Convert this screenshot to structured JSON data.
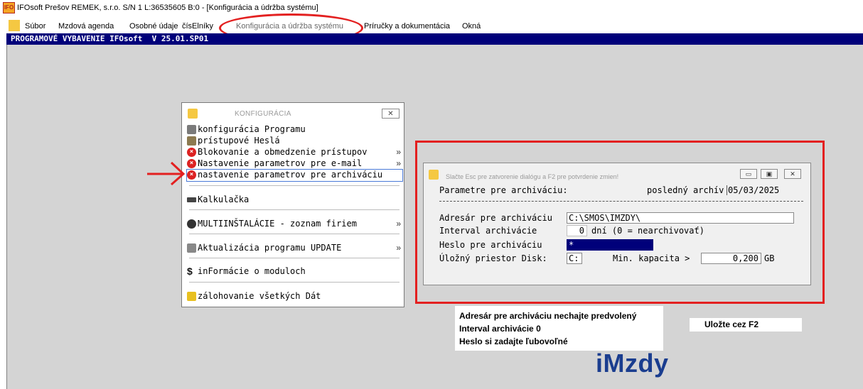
{
  "window": {
    "title": "IFOsoft Prešov REMEK, s.r.o. S/N 1 L:36535605 B:0 - [Konfigurácia a údržba systému]",
    "icon": "ifosoft-app-icon"
  },
  "menubar": {
    "items": [
      {
        "label": "Súbor"
      },
      {
        "label": "Mzdová agenda"
      },
      {
        "label": "Osobné údaje"
      },
      {
        "label": "čísElníky"
      },
      {
        "label": "Konfigurácia a údržba systému",
        "active": true
      },
      {
        "label": "Príručky a dokumentácia"
      },
      {
        "label": "Okná"
      }
    ]
  },
  "banner": {
    "text": "PROGRAMOVÉ VYBAVENIE IFOsoft  V 25.01.SP01"
  },
  "config_menu": {
    "title": "KONFIGURÁCIA",
    "close_glyph": "✕",
    "items": [
      {
        "label": "konfigurácia Programu",
        "icon": "gear-icon",
        "submenu": false
      },
      {
        "label": "prístupové Heslá",
        "icon": "key-icon",
        "submenu": false
      },
      {
        "label": "Blokovanie a obmedzenie prístupov",
        "icon": "error-icon",
        "submenu": true
      },
      {
        "label": "Nastavenie parametrov pre e-mail",
        "icon": "error-icon",
        "submenu": true
      },
      {
        "label": "nastavenie parametrov pre archiváciu",
        "icon": "error-icon",
        "submenu": false,
        "selected": true
      },
      {
        "label": "Kalkulačka",
        "icon": "calculator-icon",
        "submenu": false
      },
      {
        "label": "MULTIINŠTALÁCIE - zoznam firiem",
        "icon": "multi-install-icon",
        "submenu": true
      },
      {
        "label": "Aktualizácia programu UPDATE",
        "icon": "update-icon",
        "submenu": true
      },
      {
        "label": "inFormácie o moduloch",
        "icon": "dollar-icon",
        "submenu": false
      },
      {
        "label": "zálohovanie všetkých Dát",
        "icon": "backup-icon",
        "submenu": false
      }
    ],
    "submenu_glyph": "»"
  },
  "archive_dialog": {
    "hint": "Slačte Esc pre zatvorenie dialógu a F2 pre potvrdenie zmien!",
    "heading": "Parametre pre archiváciu:",
    "last_archive_label": "posledný archív",
    "last_archive_date": "05/03/2025",
    "separator": "------------------------------------------------------------------",
    "directory_label": "Adresár pre archiváciu",
    "directory_value": "C:\\SMOS\\IMZDY\\",
    "interval_label": "Interval archivácie",
    "interval_value": "0",
    "interval_unit": "dní  (0 = nearchivovať)",
    "password_label": "Heslo pre archiváciu",
    "password_value": "*",
    "storage_label": "Úložný priestor  Disk:",
    "disk_value": "C:",
    "min_capacity_label": "Min. kapacita >",
    "min_capacity_value": "0,200",
    "capacity_unit": "GB",
    "buttons": {
      "minimize": "▭",
      "restore": "▣",
      "close": "✕"
    }
  },
  "notes": {
    "line1": "Adresár pre archiváciu nechajte predvolený",
    "line2": "Interval archivácie 0",
    "line3": "Heslo si zadajte ľubovoľné",
    "save_hint": "Uložte cez F2",
    "logo": "iMzdy"
  },
  "colors": {
    "banner_bg": "#00007a",
    "workspace_bg": "#d4d4d4",
    "highlight_red": "#e32020",
    "logo_blue": "#1a3d8f"
  }
}
